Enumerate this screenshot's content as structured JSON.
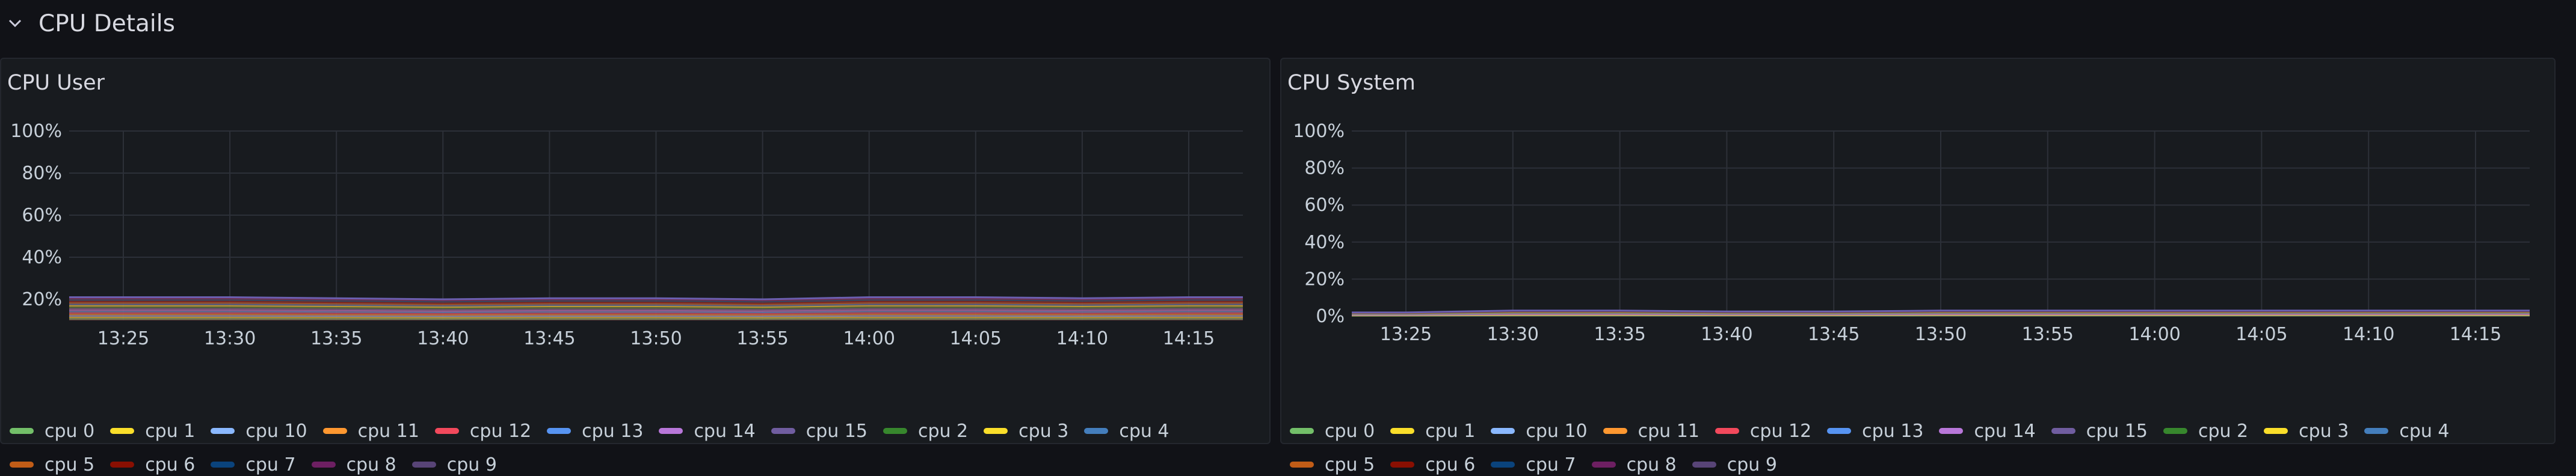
{
  "row": {
    "title": "CPU Details",
    "chevron_icon": "chevron-down-icon"
  },
  "legend": [
    {
      "label": "cpu 0",
      "color": "#73bf69"
    },
    {
      "label": "cpu 1",
      "color": "#fade2a"
    },
    {
      "label": "cpu 10",
      "color": "#8ab8ff"
    },
    {
      "label": "cpu 11",
      "color": "#ff9830"
    },
    {
      "label": "cpu 12",
      "color": "#f2495c"
    },
    {
      "label": "cpu 13",
      "color": "#5794f2"
    },
    {
      "label": "cpu 14",
      "color": "#b877d9"
    },
    {
      "label": "cpu 15",
      "color": "#705da0"
    },
    {
      "label": "cpu 2",
      "color": "#37872d"
    },
    {
      "label": "cpu 3",
      "color": "#fade2a"
    },
    {
      "label": "cpu 4",
      "color": "#447ebc"
    },
    {
      "label": "cpu 5",
      "color": "#c15c17"
    },
    {
      "label": "cpu 6",
      "color": "#890f02"
    },
    {
      "label": "cpu 7",
      "color": "#0a437c"
    },
    {
      "label": "cpu 8",
      "color": "#6d1f62"
    },
    {
      "label": "cpu 9",
      "color": "#584477"
    }
  ],
  "panels": [
    {
      "title": "CPU User",
      "chart_data": {
        "type": "area",
        "title": "CPU User",
        "x": [
          "13:25",
          "13:30",
          "13:35",
          "13:40",
          "13:45",
          "13:50",
          "13:55",
          "14:00",
          "14:05",
          "14:10",
          "14:15"
        ],
        "y_ticks": [
          "20%",
          "40%",
          "60%",
          "80%",
          "100%"
        ],
        "ylim": [
          10,
          100
        ],
        "grid": true,
        "stacked_total": [
          21,
          21,
          20.5,
          20,
          20.5,
          20.5,
          20,
          21,
          21,
          20.5,
          21
        ]
      }
    },
    {
      "title": "CPU System",
      "chart_data": {
        "type": "area",
        "title": "CPU System",
        "x": [
          "13:25",
          "13:30",
          "13:35",
          "13:40",
          "13:45",
          "13:50",
          "13:55",
          "14:00",
          "14:05",
          "14:10",
          "14:15"
        ],
        "y_ticks": [
          "0%",
          "20%",
          "40%",
          "60%",
          "80%",
          "100%"
        ],
        "ylim": [
          0,
          100
        ],
        "grid": true,
        "stacked_total": [
          2,
          3,
          3,
          2.5,
          2.5,
          3,
          3,
          3,
          3,
          3,
          3
        ]
      }
    }
  ]
}
